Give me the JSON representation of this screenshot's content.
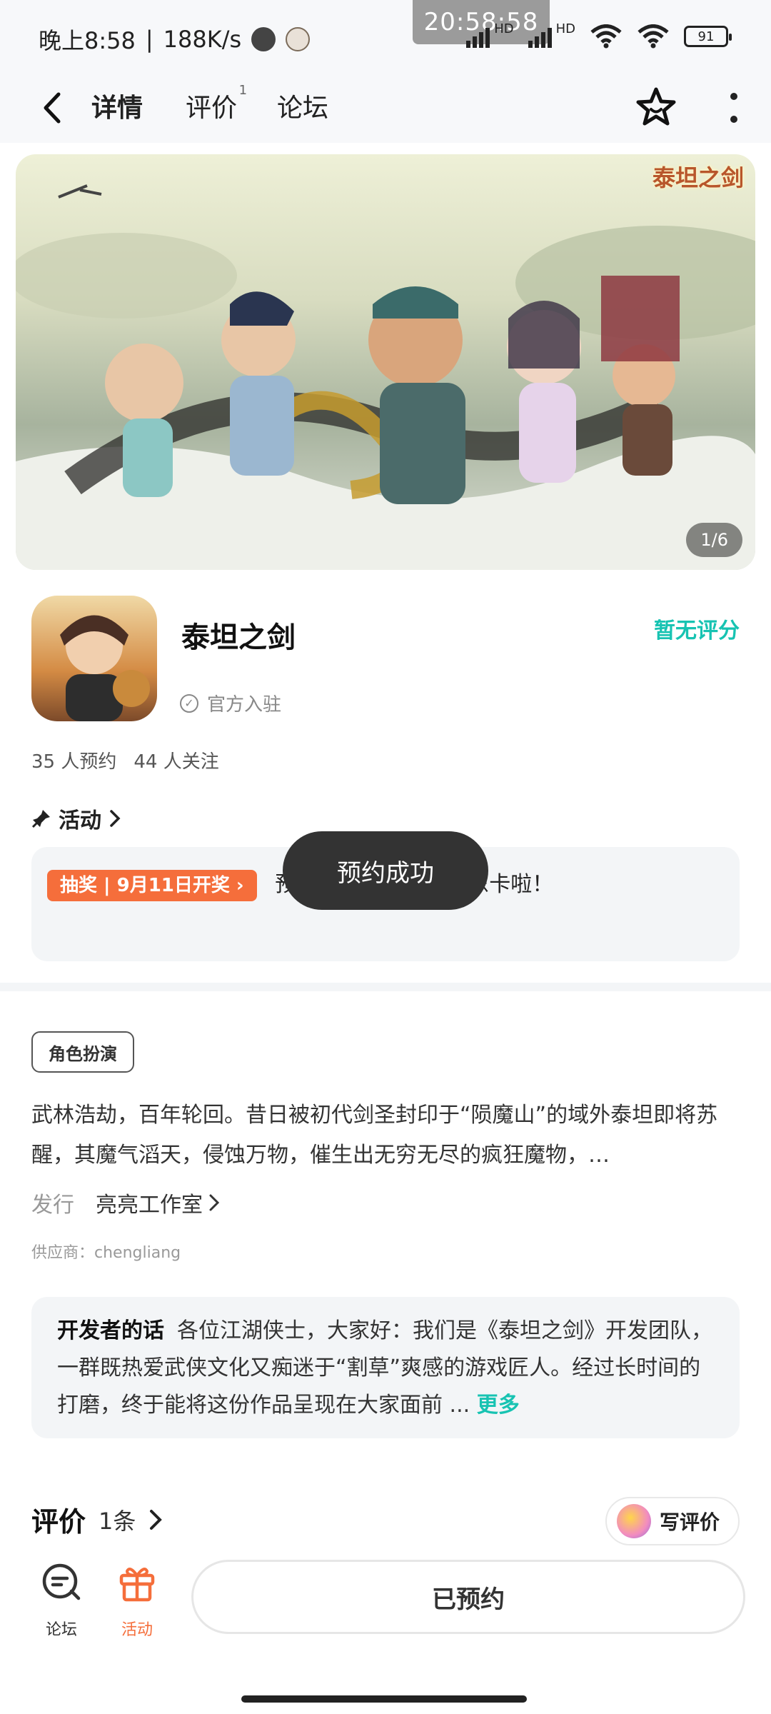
{
  "status_bar": {
    "time_text": "晚上8:58",
    "speed": "188K/s",
    "clock_overlay": "20:58:58",
    "battery": "91",
    "net_a": "HD",
    "net_b": "HD"
  },
  "nav": {
    "tabs": [
      {
        "label": "详情",
        "active": true
      },
      {
        "label": "评价",
        "badge": "1"
      },
      {
        "label": "论坛"
      }
    ]
  },
  "banner": {
    "logo": "泰坦之剑",
    "counter": "1/6"
  },
  "app": {
    "name": "泰坦之剑",
    "official": "官方入驻",
    "score": "暂无评分",
    "reservations": "35 人预约",
    "followers": "44 人关注"
  },
  "activity": {
    "heading": "活动",
    "tag": "抽奖 | 9月11日开奖",
    "text": "预约福利】预约送京东卡啦！"
  },
  "toast": "预约成功",
  "details": {
    "genre": "角色扮演",
    "description": "武林浩劫，百年轮回。昔日被初代剑圣封印于“陨魔山”的域外泰坦即将苏醒，其魔气滔天，侵蚀万物，催生出无穷无尽的疯狂魔物，…",
    "publisher_label": "发行",
    "publisher": "亮亮工作室",
    "supplier": "供应商：chengliang"
  },
  "developer_note": {
    "title": "开发者的话",
    "text": "各位江湖侠士，大家好：我们是《泰坦之剑》开发团队，一群既热爱武侠文化又痴迷于“割草”爽感的游戏匠人。经过长时间的打磨，终于能将这份作品呈现在大家面前 ...",
    "more": "更多"
  },
  "reviews": {
    "heading": "评价",
    "count": "1条",
    "write": "写评价"
  },
  "bottom": {
    "forum": "论坛",
    "activity": "活动",
    "reserved": "已预约"
  },
  "colors": {
    "accent": "#17c3b2",
    "orange": "#f56e3b",
    "toast_bg": "#333333"
  }
}
